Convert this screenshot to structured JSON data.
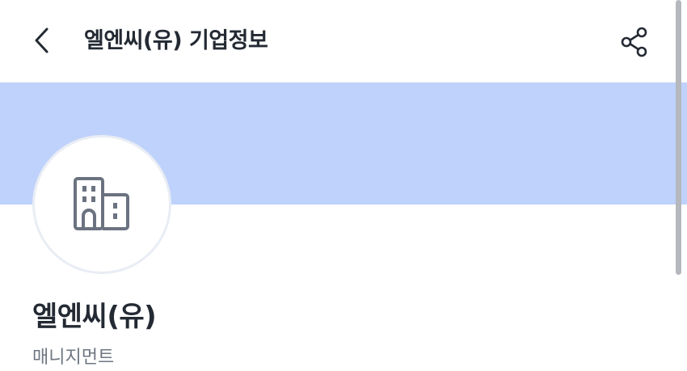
{
  "header": {
    "title": "엘엔씨(유) 기업정보",
    "back_icon": "chevron-left-icon",
    "share_icon": "share-icon"
  },
  "colors": {
    "banner": "#bfd2fb",
    "text_primary": "#242a33",
    "text_secondary": "#6e7682",
    "logo_border": "#e9edf4",
    "icon": "#6b7280"
  },
  "company": {
    "logo_icon": "building-icon",
    "name": "엘엔씨(유)",
    "category": "매니지먼트"
  }
}
